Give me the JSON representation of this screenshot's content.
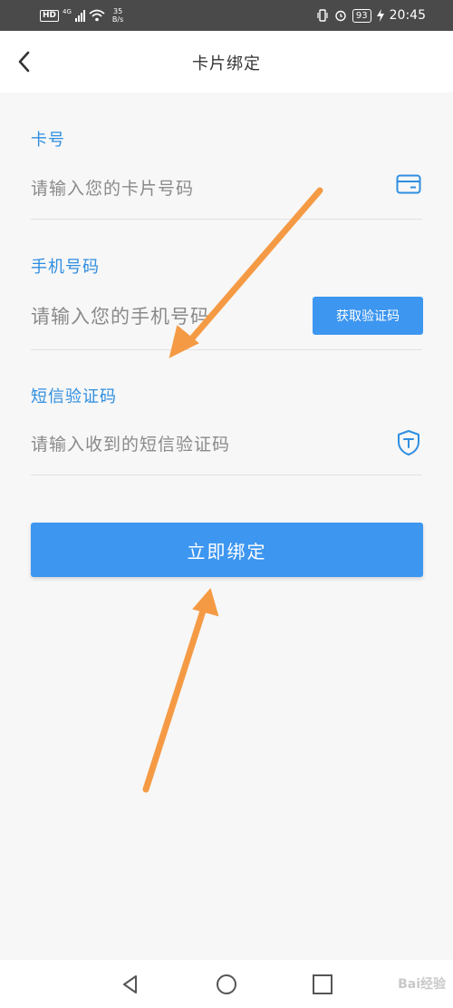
{
  "status_bar": {
    "hd": "HD",
    "network": "4G",
    "speed_value": "35",
    "speed_unit": "B/s",
    "battery": "93",
    "time": "20:45"
  },
  "header": {
    "title": "卡片绑定"
  },
  "form": {
    "card": {
      "label": "卡号",
      "placeholder": "请输入您的卡片号码",
      "value": ""
    },
    "phone": {
      "label": "手机号码",
      "placeholder": "请输入您的手机号码",
      "value": "",
      "get_code_label": "获取验证码"
    },
    "sms": {
      "label": "短信验证码",
      "placeholder": "请输入收到的短信验证码",
      "value": ""
    },
    "submit_label": "立即绑定"
  },
  "watermark": "Bai经验",
  "icons": [
    "back-chevron-icon",
    "card-icon",
    "shield-icon",
    "vibrate-icon",
    "alarm-icon",
    "charging-icon",
    "wifi-icon",
    "signal-icon",
    "nav-back-icon",
    "nav-home-icon",
    "nav-recent-icon"
  ],
  "colors": {
    "accent": "#3d96f0",
    "label": "#2f8ee0",
    "annotation_arrow": "#f59a44"
  }
}
